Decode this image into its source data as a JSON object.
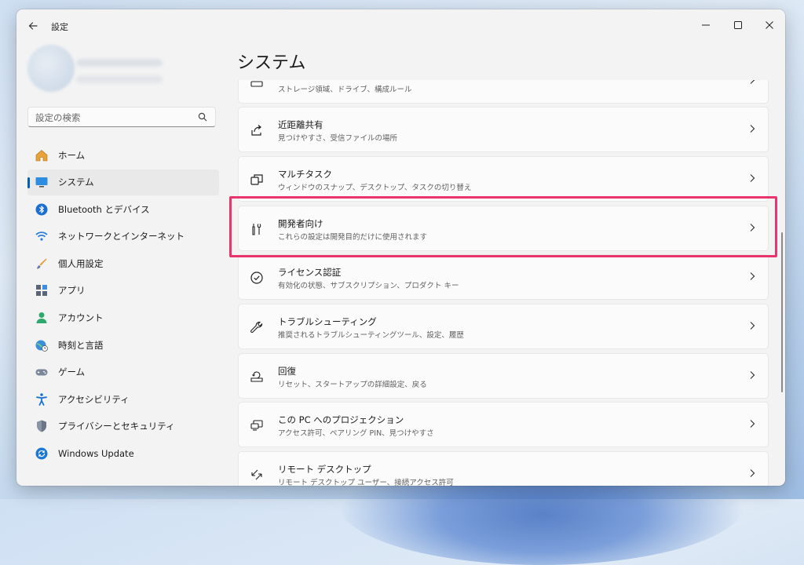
{
  "window": {
    "title": "設定",
    "back_icon": "arrow-left-icon",
    "controls": [
      "minimize-icon",
      "maximize-icon",
      "close-icon"
    ]
  },
  "search": {
    "placeholder": "設定の検索",
    "icon": "search-icon"
  },
  "sidebar": {
    "items": [
      {
        "label": "ホーム",
        "icon": "home-icon",
        "selected": false
      },
      {
        "label": "システム",
        "icon": "monitor-icon",
        "selected": true
      },
      {
        "label": "Bluetooth とデバイス",
        "icon": "bluetooth-icon",
        "selected": false
      },
      {
        "label": "ネットワークとインターネット",
        "icon": "wifi-icon",
        "selected": false
      },
      {
        "label": "個人用設定",
        "icon": "brush-icon",
        "selected": false
      },
      {
        "label": "アプリ",
        "icon": "apps-icon",
        "selected": false
      },
      {
        "label": "アカウント",
        "icon": "person-icon",
        "selected": false
      },
      {
        "label": "時刻と言語",
        "icon": "globe-clock-icon",
        "selected": false
      },
      {
        "label": "ゲーム",
        "icon": "gamepad-icon",
        "selected": false
      },
      {
        "label": "アクセシビリティ",
        "icon": "accessibility-icon",
        "selected": false
      },
      {
        "label": "プライバシーとセキュリティ",
        "icon": "shield-icon",
        "selected": false
      },
      {
        "label": "Windows Update",
        "icon": "windows-update-icon",
        "selected": false
      }
    ]
  },
  "main": {
    "title": "システム",
    "cards": [
      {
        "title": "",
        "subtitle": "ストレージ領域、ドライブ、構成ルール",
        "icon": "storage-icon"
      },
      {
        "title": "近距離共有",
        "subtitle": "見つけやすさ、受信ファイルの場所",
        "icon": "share-icon"
      },
      {
        "title": "マルチタスク",
        "subtitle": "ウィンドウのスナップ、デスクトップ、タスクの切り替え",
        "icon": "multitask-icon"
      },
      {
        "title": "開発者向け",
        "subtitle": "これらの設定は開発目的だけに使用されます",
        "icon": "developer-tools-icon"
      },
      {
        "title": "ライセンス認証",
        "subtitle": "有効化の状態、サブスクリプション、プロダクト キー",
        "icon": "check-circle-icon"
      },
      {
        "title": "トラブルシューティング",
        "subtitle": "推奨されるトラブルシューティングツール、設定、履歴",
        "icon": "wrench-icon"
      },
      {
        "title": "回復",
        "subtitle": "リセット、スタートアップの詳細設定、戻る",
        "icon": "recovery-icon"
      },
      {
        "title": "この PC へのプロジェクション",
        "subtitle": "アクセス許可、ペアリング PIN、見つけやすさ",
        "icon": "projection-icon"
      },
      {
        "title": "リモート デスクトップ",
        "subtitle": "リモート デスクトップ ユーザー、接続アクセス許可",
        "icon": "remote-desktop-icon"
      }
    ],
    "highlighted_card": "開発者向け"
  },
  "colors": {
    "accent": "#005fb8",
    "highlight": "#e8356d"
  }
}
